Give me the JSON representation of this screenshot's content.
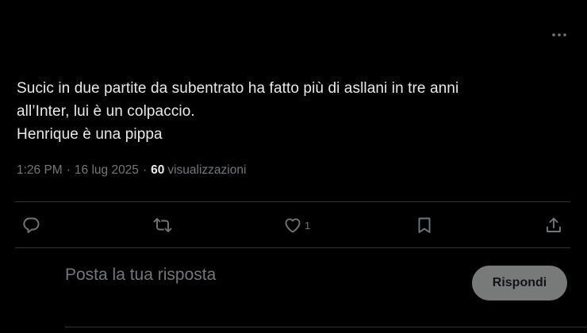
{
  "tweet": {
    "text_lines": [
      "Sucic in due partite da subentrato ha fatto più di asllani in tre anni",
      "all’Inter, lui è un colpaccio.",
      "Henrique è una pippa"
    ],
    "time": "1:26 PM",
    "separator": "·",
    "date": "16 lug 2025",
    "views_count": "60",
    "views_label": "visualizzazioni"
  },
  "actions": {
    "reply_icon": "reply-icon",
    "retweet_icon": "retweet-icon",
    "like_icon": "heart-icon",
    "like_count": "1",
    "bookmark_icon": "bookmark-icon",
    "share_icon": "share-icon",
    "more_icon": "more-icon"
  },
  "reply": {
    "placeholder": "Posta la tua risposta",
    "button_label": "Rispondi"
  },
  "colors": {
    "background": "#000000",
    "text": "#e7e9ea",
    "secondary_text": "#71767b",
    "divider": "#2f3336",
    "reply_button_bg": "#787a7a"
  }
}
